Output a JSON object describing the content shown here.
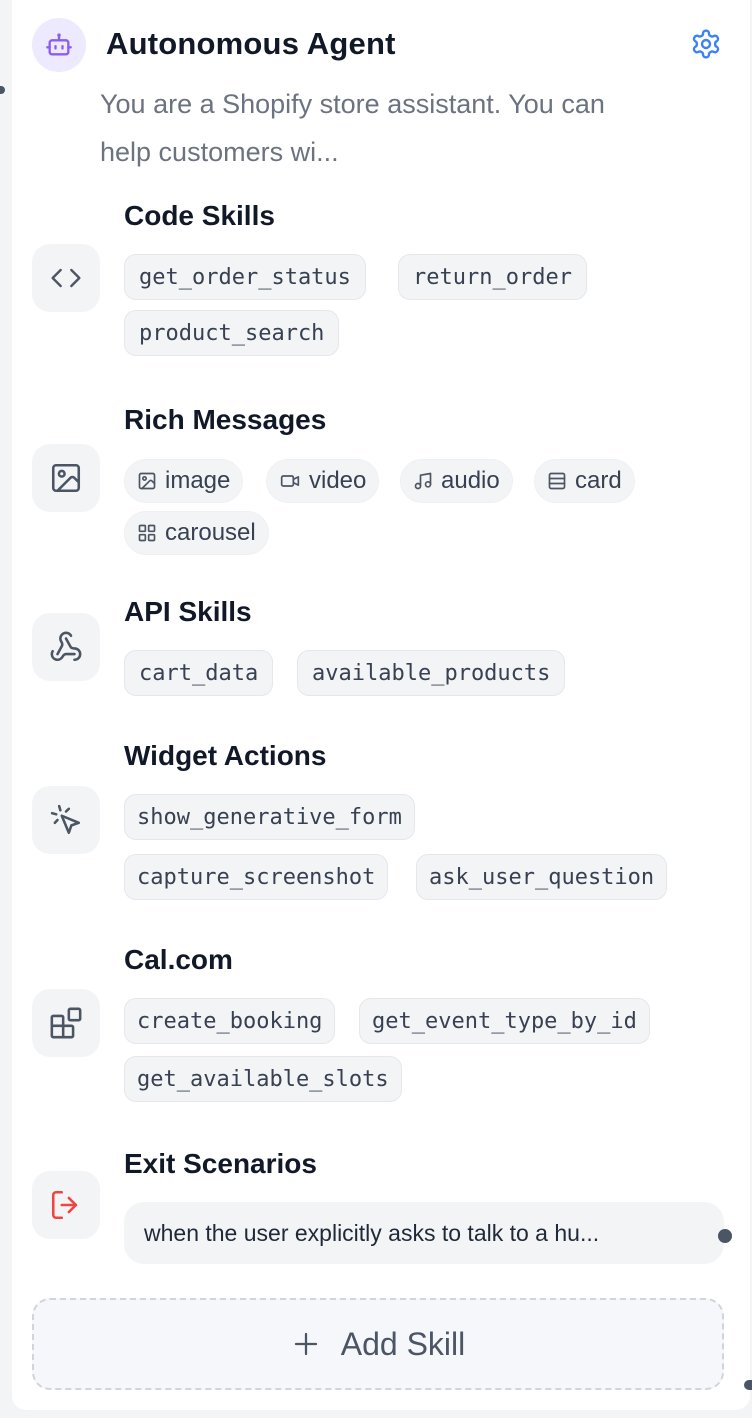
{
  "agent": {
    "title": "Autonomous Agent",
    "description_line1": "You are a Shopify store assistant. You can",
    "description_line2": "help customers wi...",
    "icon": "robot-icon",
    "accent_color": "#8b5cf6"
  },
  "sections": {
    "code_skills": {
      "title": "Code Skills",
      "icon": "code-icon",
      "items": [
        "get_order_status",
        "return_order",
        "product_search"
      ]
    },
    "rich_messages": {
      "title": "Rich Messages",
      "icon": "image-icon",
      "items": [
        {
          "label": "image",
          "icon": "image-icon"
        },
        {
          "label": "video",
          "icon": "video-icon"
        },
        {
          "label": "audio",
          "icon": "music-icon"
        },
        {
          "label": "card",
          "icon": "card-icon"
        },
        {
          "label": "carousel",
          "icon": "grid-icon"
        }
      ]
    },
    "api_skills": {
      "title": "API Skills",
      "icon": "webhook-icon",
      "items": [
        "cart_data",
        "available_products"
      ]
    },
    "widget_actions": {
      "title": "Widget Actions",
      "icon": "pointer-click-icon",
      "items": [
        "show_generative_form",
        "capture_screenshot",
        "ask_user_question"
      ]
    },
    "cal_com": {
      "title": "Cal.com",
      "icon": "app-blocks-icon",
      "items": [
        "create_booking",
        "get_event_type_by_id",
        "get_available_slots"
      ]
    },
    "exit_scenarios": {
      "title": "Exit Scenarios",
      "icon": "exit-icon",
      "exit_color": "#ef4444",
      "value": "when the user explicitly asks to talk to a hu..."
    }
  },
  "add_skill": {
    "label": "Add Skill",
    "icon": "plus-icon"
  },
  "settings_icon": "gear-icon",
  "settings_color": "#3b82f6"
}
